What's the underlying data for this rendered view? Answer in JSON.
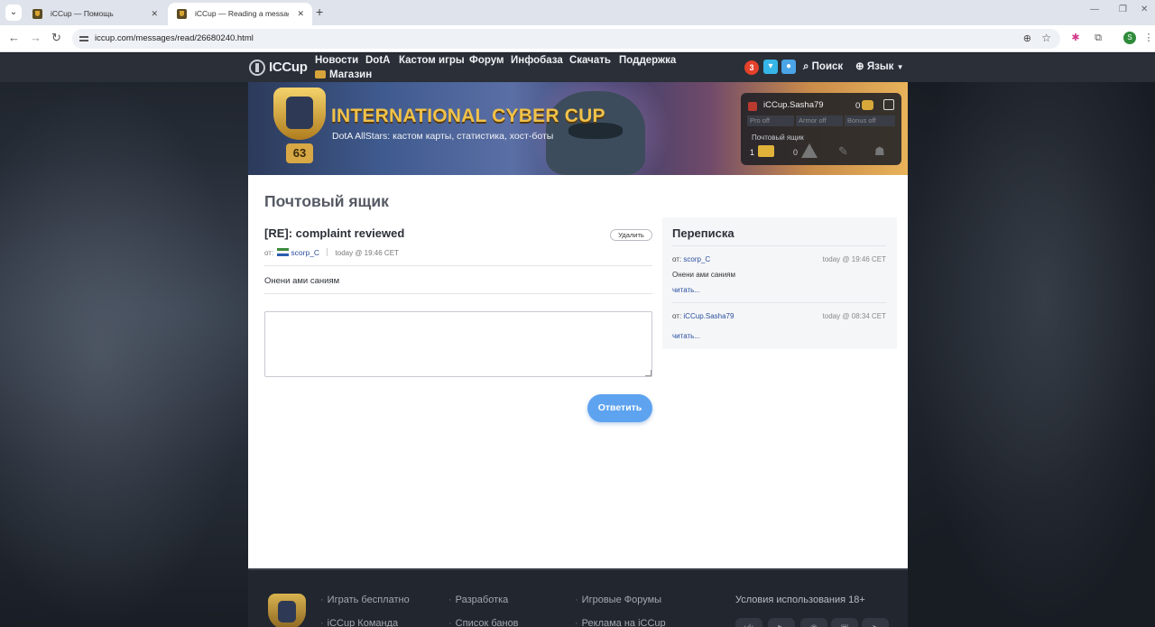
{
  "browser": {
    "tabs": [
      {
        "title": "iCCup — Помощь",
        "active": false
      },
      {
        "title": "iCCup — Reading a message fr",
        "active": true
      }
    ],
    "url": "iccup.com/messages/read/26680240.html",
    "profile_initial": "S",
    "icons": [
      "tab-search-icon",
      "back-icon",
      "forward-icon",
      "reload-icon",
      "site-info-icon",
      "zoom-icon",
      "bookmark-star-icon",
      "extension-icon",
      "puzzle-icon",
      "menu-icon"
    ]
  },
  "nav": {
    "logo": "ICCup",
    "links": [
      "Новости",
      "DotA",
      "Кастом игры",
      "Форум",
      "Инфобаза",
      "Скачать",
      "Поддержка"
    ],
    "shop": "Магазин",
    "notifications": "3",
    "search": "Поиск",
    "language": "Язык"
  },
  "banner": {
    "title": "INTERNATIONAL CYBER CUP",
    "subtitle": "DotA AllStars: кастом карты, статистика, хост-боты",
    "level": "63"
  },
  "user_panel": {
    "username": "iCCup.Sasha79",
    "coins": "0",
    "statuses": [
      "Pro off",
      "Armor off",
      "Bonus off"
    ],
    "mailbox_label": "Почтовый ящик",
    "mail_count": "1",
    "warnings_count": "0"
  },
  "page": {
    "title": "Почтовый ящик",
    "message": {
      "subject": "[RE]: complaint reviewed",
      "delete_label": "Удалить",
      "from_label": "от:",
      "sender": "scorp_C",
      "date": "today @ 19:46 CET",
      "body": "Онени ами саниям"
    },
    "reply_button": "Ответить"
  },
  "sidebar": {
    "title": "Переписка",
    "items": [
      {
        "from_label": "от:",
        "sender": "scorp_C",
        "date": "today @ 19:46 CET",
        "text": "Онени ами саниям",
        "read_label": "читать..."
      },
      {
        "from_label": "от:",
        "sender": "iCCup.Sasha79",
        "date": "today @ 08:34 CET",
        "text": "",
        "read_label": "читать..."
      }
    ]
  },
  "footer": {
    "col1": [
      "Играть бесплатно",
      "iCCup Команда"
    ],
    "col2": [
      "Разработка",
      "Список банов"
    ],
    "col3": [
      "Игровые Форумы",
      "Реклама на iCCup"
    ],
    "terms": "Условия использования 18+",
    "social": [
      "vk-icon",
      "youtube-icon",
      "discord-icon",
      "twitch-icon",
      "telegram-icon"
    ]
  },
  "colors": {
    "accent": "#5ea3ef",
    "link": "#2a4f9e",
    "badge": "#e5412b",
    "gold": "#f0c24a",
    "nav_bg": "#2a2f38"
  }
}
